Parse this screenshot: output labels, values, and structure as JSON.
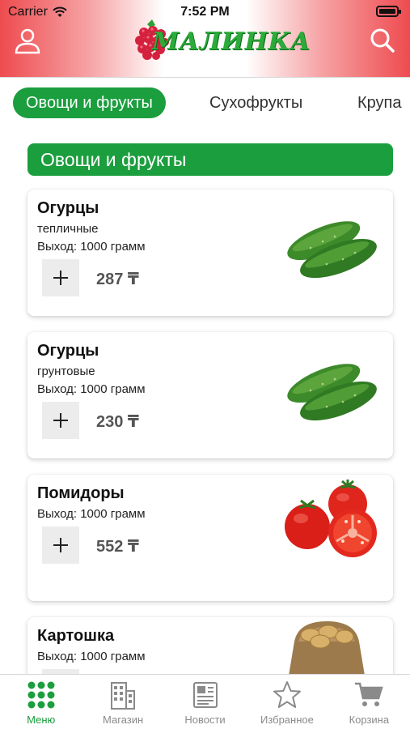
{
  "status_bar": {
    "carrier": "Carrier",
    "time": "7:52 PM"
  },
  "header": {
    "logo_text": "МАЛИНКА"
  },
  "tabs": [
    {
      "label": "Овощи и фрукты",
      "active": true
    },
    {
      "label": "Сухофрукты",
      "active": false
    },
    {
      "label": "Крупа",
      "active": false
    }
  ],
  "section": {
    "title": "Овощи и фрукты"
  },
  "products": [
    {
      "name": "Огурцы",
      "variety": "тепличные",
      "yield": "Выход: 1000 грамм",
      "price": "287 ₸",
      "image": "cucumber-image"
    },
    {
      "name": "Огурцы",
      "variety": "грунтовые",
      "yield": "Выход: 1000 грамм",
      "price": "230 ₸",
      "image": "cucumber-image"
    },
    {
      "name": "Помидоры",
      "variety": "",
      "yield": "Выход: 1000 грамм",
      "price": "552 ₸",
      "image": "tomato-image"
    },
    {
      "name": "Картошка",
      "variety": "",
      "yield": "Выход: 1000 грамм",
      "price": "",
      "image": "potato-image"
    }
  ],
  "bottom_nav": [
    {
      "label": "Меню",
      "icon": "grid-icon",
      "active": true
    },
    {
      "label": "Магазин",
      "icon": "building-icon",
      "active": false
    },
    {
      "label": "Новости",
      "icon": "newspaper-icon",
      "active": false
    },
    {
      "label": "Избранное",
      "icon": "star-icon",
      "active": false
    },
    {
      "label": "Корзина",
      "icon": "cart-icon",
      "active": false
    }
  ],
  "colors": {
    "accent": "#1b9e3e",
    "header_red": "#ee4b4f",
    "price_gray": "#555555"
  }
}
